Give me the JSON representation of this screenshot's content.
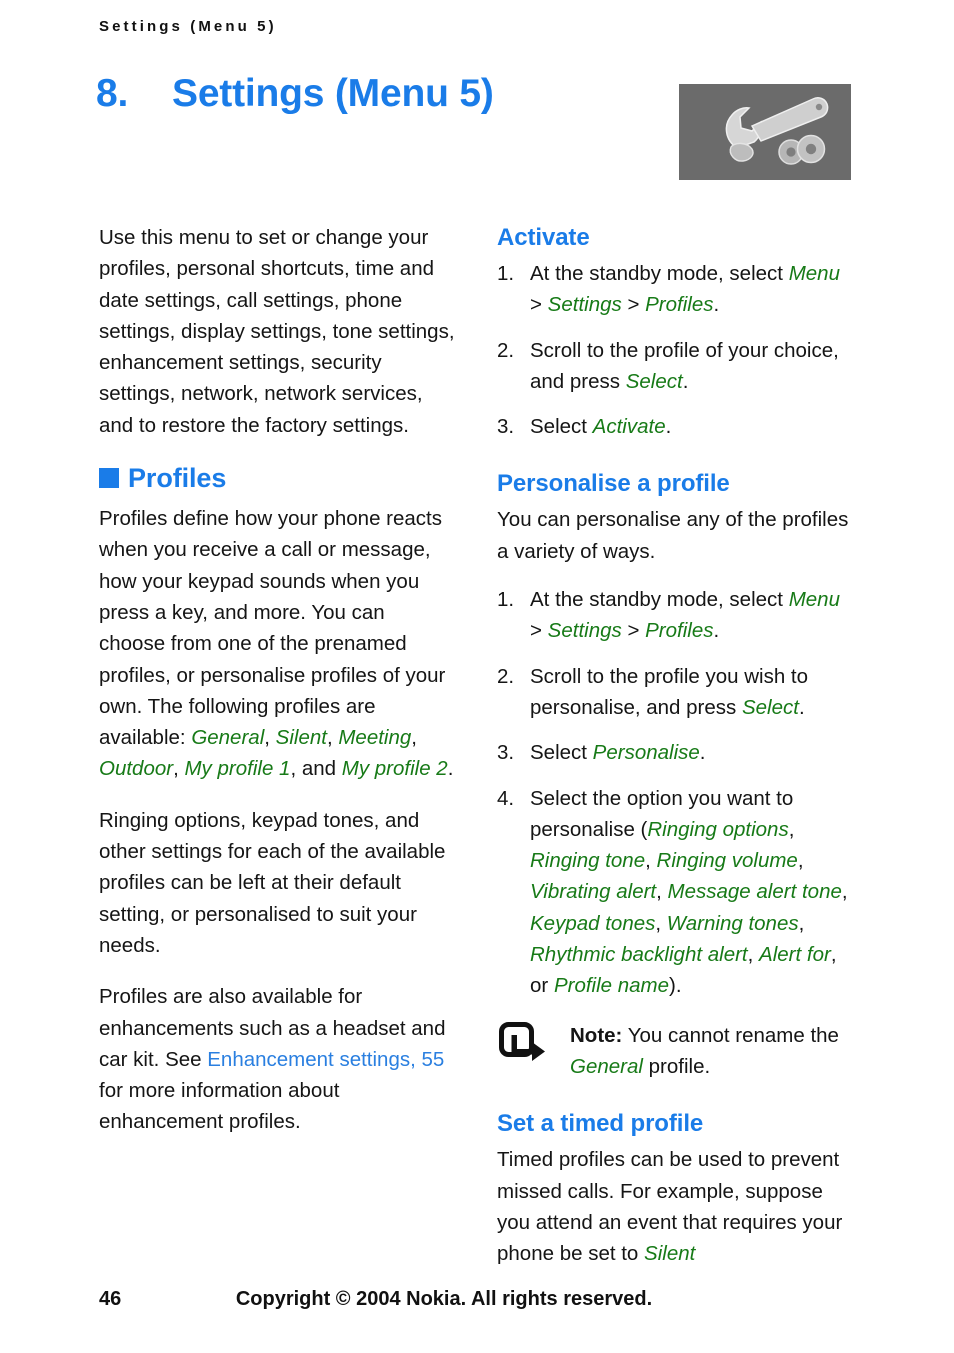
{
  "header": {
    "running_title": "Settings (Menu 5)"
  },
  "chapter": {
    "number": "8.",
    "title": "Settings (Menu 5)",
    "icon": "wrench-and-bolts-icon",
    "icon_background": "#6b6b6b"
  },
  "colors": {
    "heading_blue": "#1a7ce8",
    "ui_green": "#177a17",
    "link_blue": "#2a7fe0",
    "body_black": "#151515"
  },
  "left_column": {
    "intro": "Use this menu to set or change your profiles, personal shortcuts, time and date settings, call settings, phone settings, display settings, tone settings, enhancement settings, security settings, network, network services, and to restore the factory settings.",
    "profiles_heading": "Profiles",
    "para_1_before": "Profiles define how your phone reacts when you receive a call or message, how your keypad sounds when you press a key, and more. You can choose from one of the prenamed profiles, or personalise profiles of your own. The following profiles are available: ",
    "profile_general": "General",
    "profile_silent": "Silent",
    "profile_meeting": "Meeting",
    "profile_outdoor": "Outdoor",
    "profile_my1": "My profile 1",
    "profile_my2": "My profile 2",
    "sep_comma": ", ",
    "sep_and": ", and ",
    "sep_period": ".",
    "para_2": "Ringing options, keypad tones, and other settings for each of the available profiles can be left at their default setting, or personalised to suit your needs.",
    "para_3_before": "Profiles are also available for enhancements such as a headset and car kit. See ",
    "para_3_link": "Enhancement settings, 55",
    "para_3_after": " for more information about enhancement profiles."
  },
  "right_column": {
    "activate": {
      "heading": "Activate",
      "steps": [
        {
          "marker": "1.",
          "text_before": "At the standby mode, select ",
          "ui_1": "Menu",
          "sep_1": " > ",
          "ui_2": "Settings",
          "sep_2": " > ",
          "ui_3": "Profiles",
          "text_after": "."
        },
        {
          "marker": "2.",
          "text_before": "Scroll to the profile of your choice, and press ",
          "ui_1": "Select",
          "text_after": "."
        },
        {
          "marker": "3.",
          "text_before": "Select ",
          "ui_1": "Activate",
          "text_after": "."
        }
      ]
    },
    "personalise": {
      "heading": "Personalise a profile",
      "intro": "You can personalise any of the profiles a variety of ways.",
      "steps": [
        {
          "marker": "1.",
          "text_before": "At the standby mode, select ",
          "ui_1": "Menu",
          "sep_1": " > ",
          "ui_2": "Settings",
          "sep_2": " > ",
          "ui_3": "Profiles",
          "text_after": "."
        },
        {
          "marker": "2.",
          "text_before": "Scroll to the profile you wish to personalise, and press ",
          "ui_1": "Select",
          "text_after": "."
        },
        {
          "marker": "3.",
          "text_before": "Select ",
          "ui_1": "Personalise",
          "text_after": "."
        },
        {
          "marker": "4.",
          "text_before": "Select the option you want to personalise (",
          "options": [
            "Ringing options",
            "Ringing tone",
            "Ringing volume",
            "Vibrating alert",
            "Message alert tone",
            "Keypad tones",
            "Warning tones",
            "Rhythmic backlight alert",
            "Alert for"
          ],
          "option_last": "Profile name",
          "sep_comma": ", ",
          "sep_or": ", or ",
          "text_after": ")."
        }
      ],
      "note": {
        "icon": "note-arrow-icon",
        "label": "Note:",
        "text_before": " You cannot rename the ",
        "ui_1": "General",
        "text_after": " profile."
      }
    },
    "timed_profile": {
      "heading": "Set a timed profile",
      "text_before": "Timed profiles can be used to prevent missed calls. For example, suppose you attend an event that requires your phone be set to ",
      "ui_1": "Silent"
    }
  },
  "footer": {
    "page_number": "46",
    "copyright": "Copyright © 2004 Nokia. All rights reserved."
  }
}
